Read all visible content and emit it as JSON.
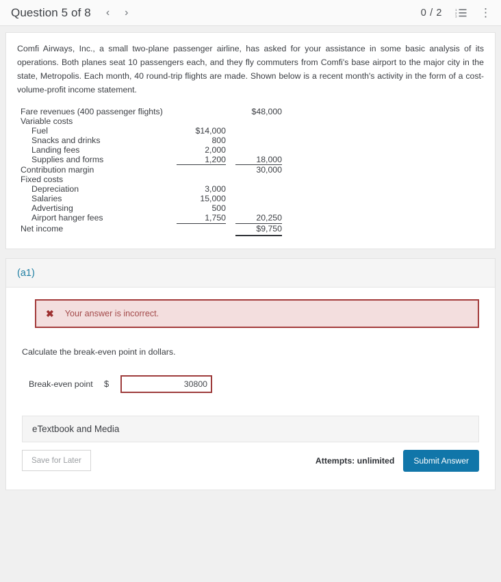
{
  "header": {
    "title": "Question 5 of 8",
    "prev_icon": "chevron-left-icon",
    "next_icon": "chevron-right-icon",
    "score": "0 / 2",
    "list_icon": "numbered-list-icon",
    "menu_icon": "kebab-menu-icon"
  },
  "problem": {
    "intro": "Comfi Airways, Inc., a small two-plane passenger airline, has asked for your assistance in some basic analysis of its operations. Both planes seat 10 passengers each, and they fly commuters from Comfi's base airport to the major city in the state, Metropolis. Each month, 40 round-trip flights are made. Shown below is a recent month's activity in the form of a cost-volume-profit income statement."
  },
  "statement": {
    "rows": [
      {
        "label": "Fare revenues (400 passenger flights)",
        "col1": "",
        "col2": "$48,000",
        "indent": false
      },
      {
        "label": "Variable costs",
        "col1": "",
        "col2": "",
        "indent": false
      },
      {
        "label": "Fuel",
        "col1": "$14,000",
        "col2": "",
        "indent": true
      },
      {
        "label": "Snacks and drinks",
        "col1": "800",
        "col2": "",
        "indent": true
      },
      {
        "label": "Landing fees",
        "col1": "2,000",
        "col2": "",
        "indent": true
      },
      {
        "label": "Supplies and forms",
        "col1": "1,200",
        "col2": "18,000",
        "indent": true
      },
      {
        "label": "Contribution margin",
        "col1": "",
        "col2": "30,000",
        "indent": false
      },
      {
        "label": "Fixed costs",
        "col1": "",
        "col2": "",
        "indent": false
      },
      {
        "label": "Depreciation",
        "col1": "3,000",
        "col2": "",
        "indent": true
      },
      {
        "label": "Salaries",
        "col1": "15,000",
        "col2": "",
        "indent": true
      },
      {
        "label": "Advertising",
        "col1": "500",
        "col2": "",
        "indent": true
      },
      {
        "label": "Airport hanger fees",
        "col1": "1,750",
        "col2": "20,250",
        "indent": true
      },
      {
        "label": "Net income",
        "col1": "",
        "col2": "$9,750",
        "indent": false
      }
    ]
  },
  "answer_section": {
    "part_label": "(a1)",
    "alert": {
      "icon": "error-x-icon",
      "message": "Your answer is incorrect."
    },
    "prompt": "Calculate the break-even point in dollars.",
    "field": {
      "label": "Break-even point",
      "currency_symbol": "$",
      "value": "30800",
      "placeholder": ""
    },
    "etextbook_label": "eTextbook and Media",
    "save_label": "Save for Later",
    "attempts_label": "Attempts: unlimited",
    "submit_label": "Submit Answer"
  },
  "colors": {
    "accent_blue": "#1176a9",
    "part_label_teal": "#1f7fa3",
    "error_border": "#a33a3a",
    "error_bg": "#f3dede",
    "error_text": "#a34a4a",
    "page_bg": "#f0f0f0"
  }
}
